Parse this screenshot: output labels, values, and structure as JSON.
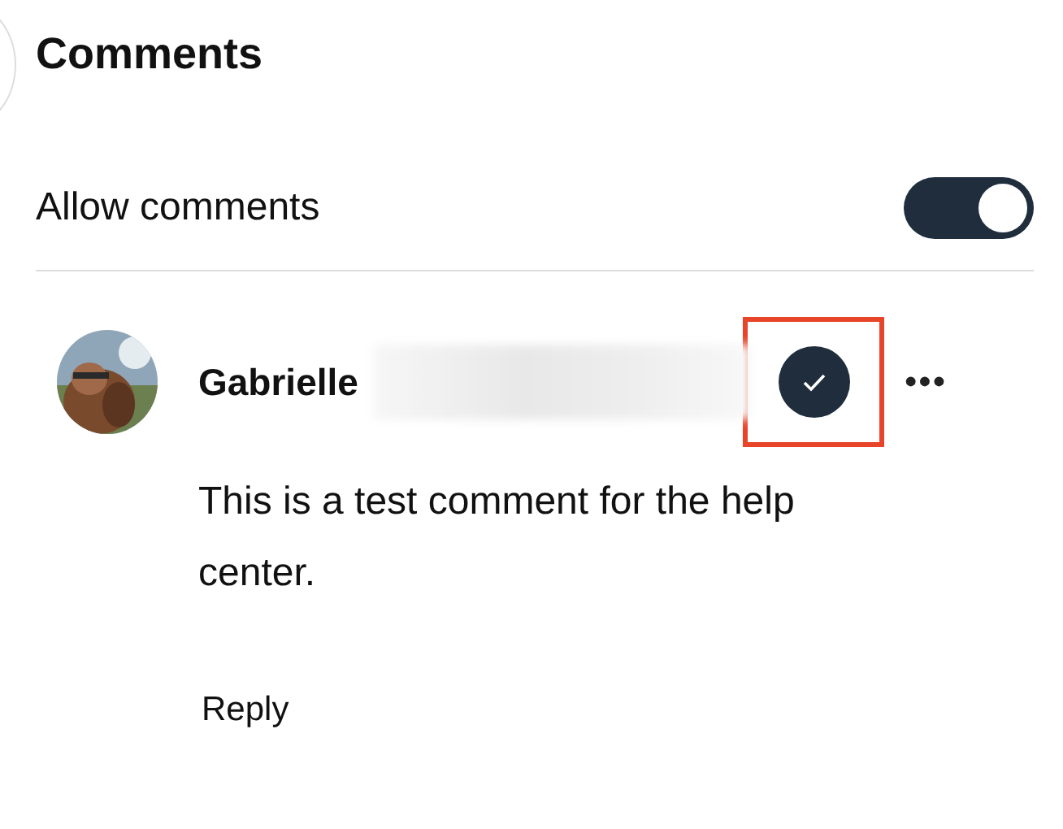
{
  "title": "Comments",
  "allow_comments": {
    "label": "Allow comments",
    "on": true
  },
  "comments": [
    {
      "author": "Gabrielle",
      "resolved": true,
      "highlighted": true,
      "more": "•••",
      "text": "This is a test comment for the help center.",
      "reply": "Reply"
    }
  ]
}
